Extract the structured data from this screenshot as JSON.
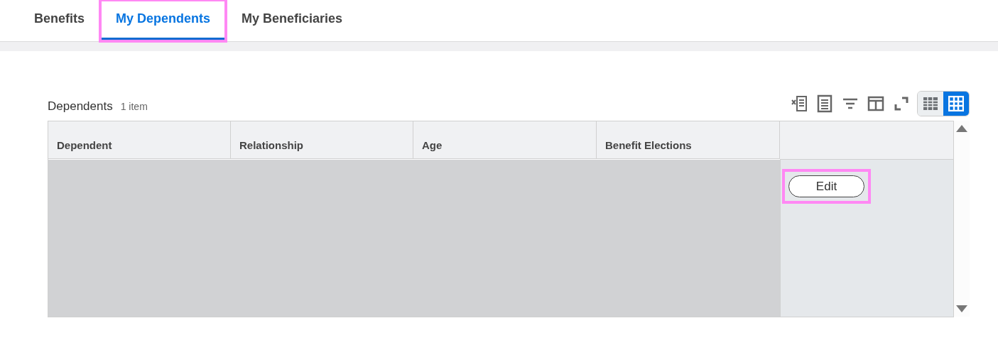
{
  "tabs": [
    {
      "label": "Benefits",
      "selected": false,
      "highlighted": false
    },
    {
      "label": "My Dependents",
      "selected": true,
      "highlighted": true
    },
    {
      "label": "My Beneficiaries",
      "selected": false,
      "highlighted": false
    }
  ],
  "grid": {
    "title": "Dependents",
    "count": "1 item",
    "toolbar": [
      {
        "kind": "excel"
      },
      {
        "kind": "pdf"
      },
      {
        "kind": "filter"
      },
      {
        "kind": "columns"
      },
      {
        "kind": "fullscreen"
      }
    ],
    "view_toggle": [
      {
        "kind": "table",
        "selected": false
      },
      {
        "kind": "grid",
        "selected": true
      }
    ],
    "columns": [
      "Dependent",
      "Relationship",
      "Age",
      "Benefit Elections"
    ],
    "rows": [
      {
        "selected": true,
        "action": {
          "label": "Edit",
          "highlighted": true
        }
      }
    ]
  }
}
